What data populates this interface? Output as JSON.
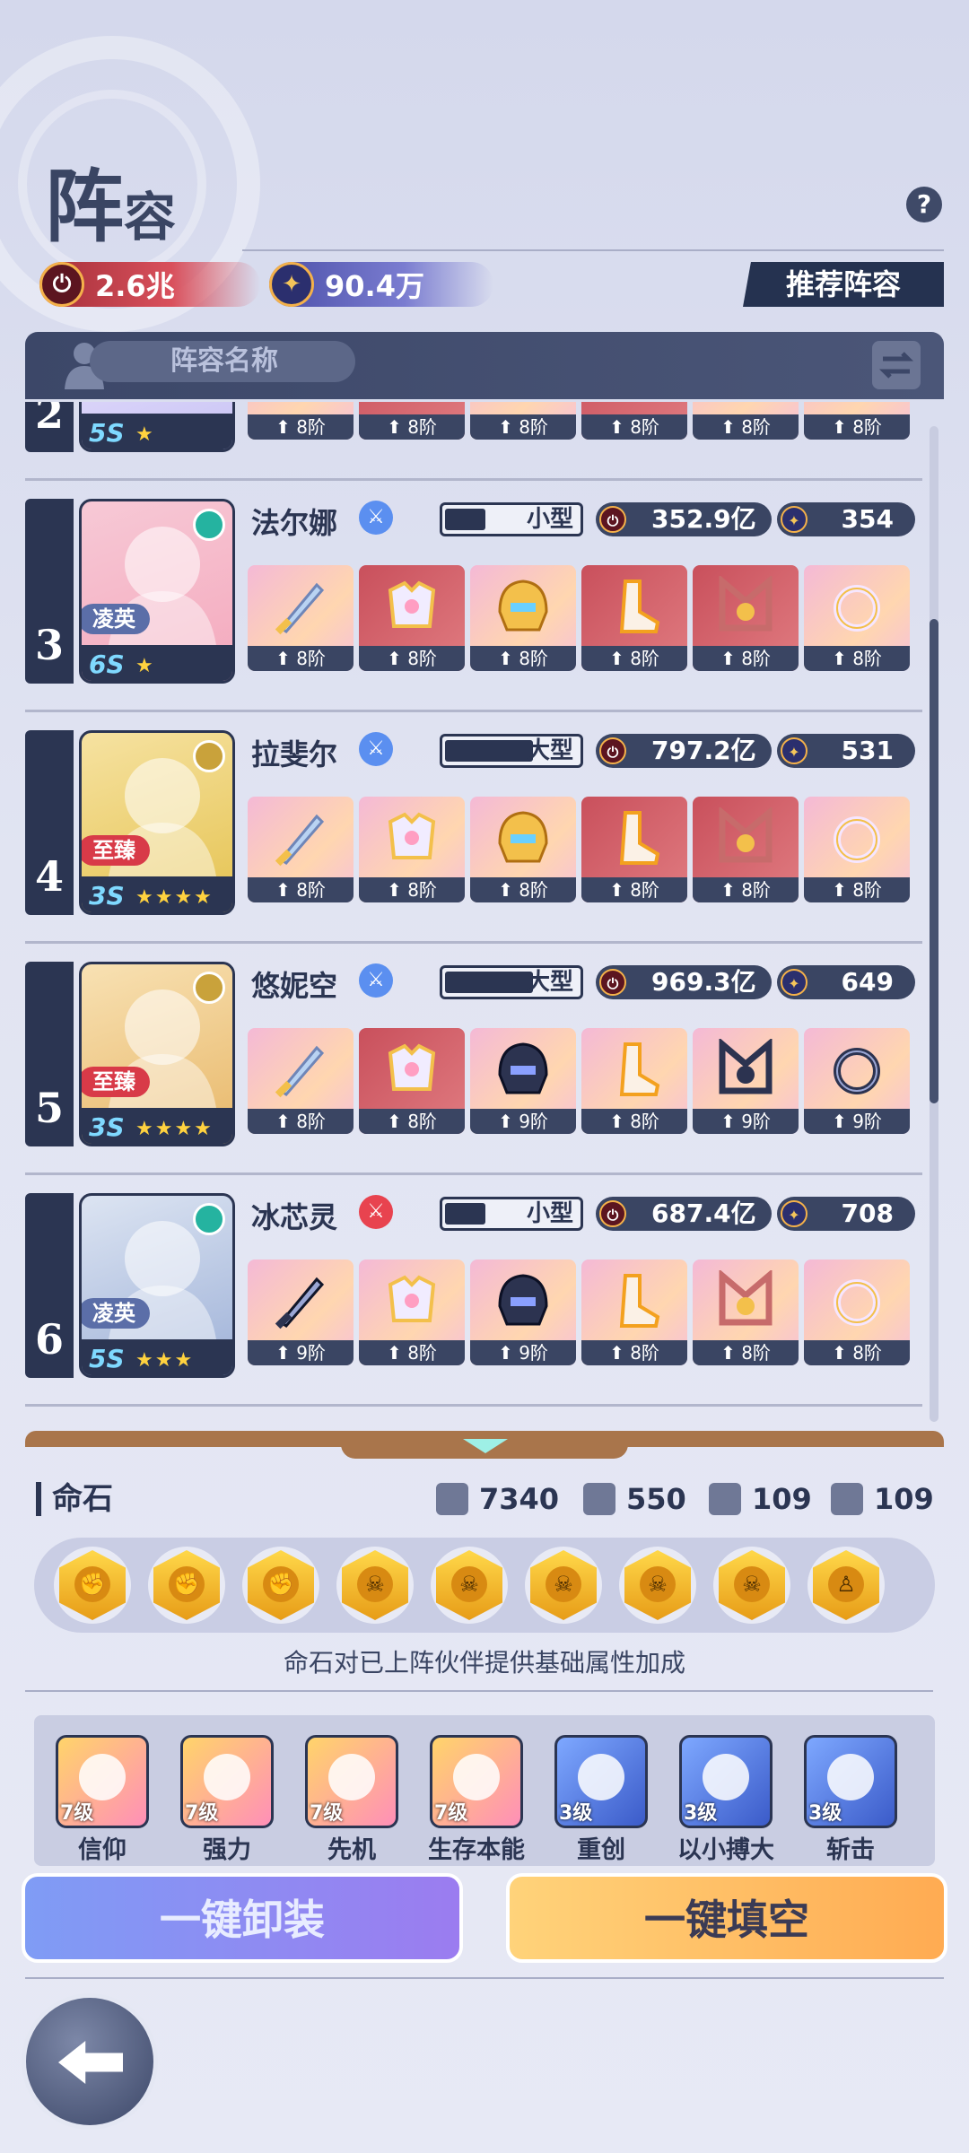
{
  "header": {
    "title_big": "阵",
    "title_small": "容",
    "help_icon": "?"
  },
  "resources": {
    "power": "2.6兆",
    "gems": "90.4万",
    "recommend_btn": "推荐阵容"
  },
  "team": {
    "name_placeholder": "阵容名称"
  },
  "partial_row": {
    "rank": "2",
    "star_level": "5S",
    "slot_level": "8阶"
  },
  "heroes": [
    {
      "rank": "3",
      "name": "法尔娜",
      "class_color": "#5b8ff0",
      "size": "小型",
      "size_fill": 0.3,
      "power": "352.9亿",
      "score": "354",
      "badge": "凌英",
      "badge_color": "#5b6ea8",
      "star_level": "6S",
      "stars": "★",
      "portrait": [
        "#f7c9d6",
        "#f4a9bd"
      ],
      "elem_color": "#25b3a0",
      "slots": [
        {
          "type": "pink",
          "lvl": "8阶",
          "art": "sword"
        },
        {
          "type": "red",
          "lvl": "8阶",
          "art": "armor"
        },
        {
          "type": "pink",
          "lvl": "8阶",
          "art": "helm"
        },
        {
          "type": "red",
          "lvl": "8阶",
          "art": "boot"
        },
        {
          "type": "red",
          "lvl": "8阶",
          "art": "neck"
        },
        {
          "type": "pink",
          "lvl": "8阶",
          "art": "ring"
        }
      ]
    },
    {
      "rank": "4",
      "name": "拉斐尔",
      "class_color": "#5b8ff0",
      "size": "大型",
      "size_fill": 0.65,
      "power": "797.2亿",
      "score": "531",
      "badge": "至臻",
      "badge_color": "#d83a48",
      "star_level": "3S",
      "stars": "★★★★",
      "portrait": [
        "#f6e2a1",
        "#e5c351"
      ],
      "elem_color": "#c9a23b",
      "slots": [
        {
          "type": "pink",
          "lvl": "8阶",
          "art": "sword"
        },
        {
          "type": "pink",
          "lvl": "8阶",
          "art": "armor"
        },
        {
          "type": "pink",
          "lvl": "8阶",
          "art": "helm"
        },
        {
          "type": "red",
          "lvl": "8阶",
          "art": "boot"
        },
        {
          "type": "red",
          "lvl": "8阶",
          "art": "neck"
        },
        {
          "type": "pink",
          "lvl": "8阶",
          "art": "ring"
        }
      ]
    },
    {
      "rank": "5",
      "name": "悠妮空",
      "class_color": "#5b8ff0",
      "size": "大型",
      "size_fill": 0.65,
      "power": "969.3亿",
      "score": "649",
      "badge": "至臻",
      "badge_color": "#d83a48",
      "star_level": "3S",
      "stars": "★★★★",
      "portrait": [
        "#f8e1b3",
        "#e8b86a"
      ],
      "elem_color": "#c9a23b",
      "slots": [
        {
          "type": "pink",
          "lvl": "8阶",
          "art": "sword"
        },
        {
          "type": "red",
          "lvl": "8阶",
          "art": "armor"
        },
        {
          "type": "pink",
          "lvl": "9阶",
          "art": "darkhelm"
        },
        {
          "type": "pink",
          "lvl": "8阶",
          "art": "boot"
        },
        {
          "type": "pink",
          "lvl": "9阶",
          "art": "darkneck"
        },
        {
          "type": "pink",
          "lvl": "9阶",
          "art": "darkring"
        }
      ]
    },
    {
      "rank": "6",
      "name": "冰芯灵",
      "class_color": "#e8434f",
      "size": "小型",
      "size_fill": 0.3,
      "power": "687.4亿",
      "score": "708",
      "badge": "凌英",
      "badge_color": "#5b6ea8",
      "star_level": "5S",
      "stars": "★★★",
      "portrait": [
        "#dce4f2",
        "#9fb2d8"
      ],
      "elem_color": "#25b3a0",
      "slots": [
        {
          "type": "pink",
          "lvl": "9阶",
          "art": "darksword"
        },
        {
          "type": "pink",
          "lvl": "8阶",
          "art": "armor"
        },
        {
          "type": "pink",
          "lvl": "9阶",
          "art": "darkhelm"
        },
        {
          "type": "pink",
          "lvl": "8阶",
          "art": "boot"
        },
        {
          "type": "pink",
          "lvl": "8阶",
          "art": "neck"
        },
        {
          "type": "pink",
          "lvl": "8阶",
          "art": "ring"
        }
      ]
    }
  ],
  "fate_stone": {
    "title": "命石",
    "stats": [
      "7340",
      "550",
      "109",
      "109"
    ],
    "stones": [
      "fist",
      "fist",
      "fist",
      "skull",
      "skull",
      "skull",
      "skull",
      "skull",
      "halo"
    ],
    "hint": "命石对已上阵伙伴提供基础属性加成"
  },
  "skills": [
    {
      "lvl": "7级",
      "name": "信仰",
      "style": "gold"
    },
    {
      "lvl": "7级",
      "name": "强力",
      "style": "gold"
    },
    {
      "lvl": "7级",
      "name": "先机",
      "style": "gold"
    },
    {
      "lvl": "7级",
      "name": "生存本能",
      "style": "gold"
    },
    {
      "lvl": "3级",
      "name": "重创",
      "style": "blue"
    },
    {
      "lvl": "3级",
      "name": "以小搏大",
      "style": "blue"
    },
    {
      "lvl": "3级",
      "name": "斩击",
      "style": "blue"
    }
  ],
  "actions": {
    "unequip_all": "一键卸装",
    "fill_all": "一键填空"
  }
}
